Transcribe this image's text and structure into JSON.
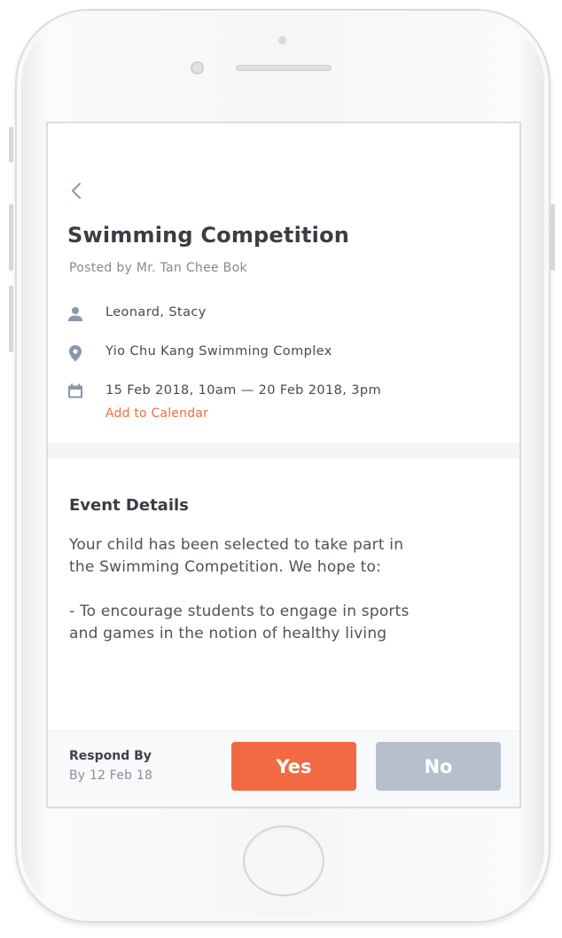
{
  "event": {
    "title": "Swimming Competition",
    "posted_by": "Posted by Mr. Tan Chee Bok",
    "attendees": "Leonard, Stacy",
    "location": "Yio Chu Kang Swimming Complex",
    "datetime": "15 Feb 2018, 10am — 20 Feb 2018, 3pm",
    "add_to_calendar": "Add to Calendar"
  },
  "details": {
    "heading": "Event Details",
    "lines": [
      "Your child has been selected to take part in",
      "the Swimming Competition. We hope to:",
      "-  To encourage students to engage in sports",
      "and games in the notion of healthy living"
    ]
  },
  "footer": {
    "respond_label": "Respond By",
    "respond_date": "By 12 Feb 18",
    "yes_label": "Yes",
    "no_label": "No"
  },
  "icons": {
    "back": "chevron-left-icon",
    "attendees": "person-icon",
    "location": "map-pin-icon",
    "date": "calendar-icon"
  },
  "colors": {
    "accent": "#f16a43",
    "link": "#ee6d44",
    "disabled_button": "#b6bfcb",
    "icon": "#8a96aa",
    "title": "#3a3d44"
  }
}
